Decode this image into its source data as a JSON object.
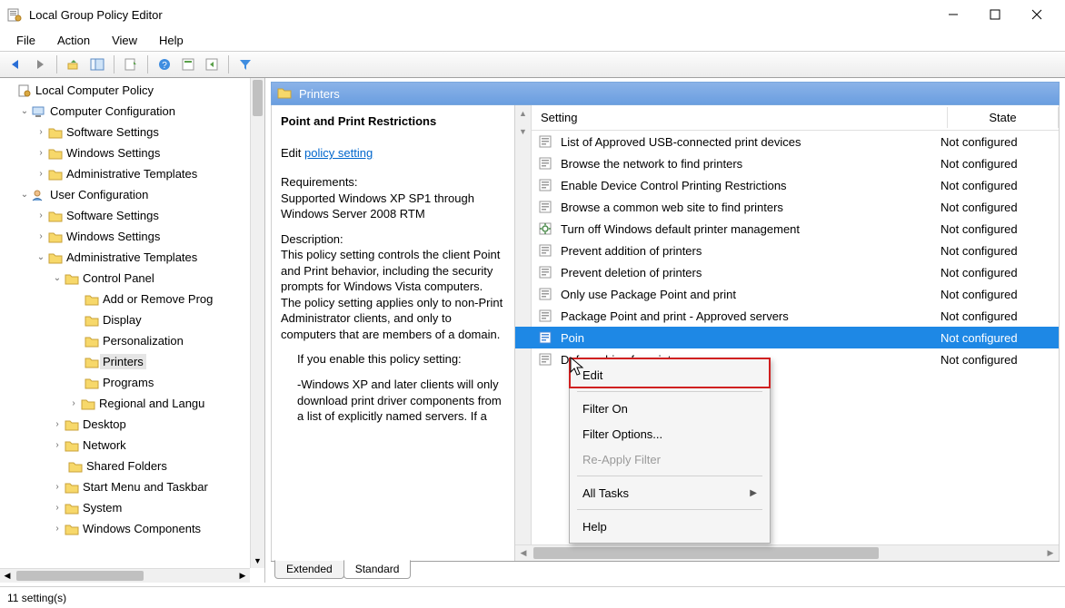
{
  "window": {
    "title": "Local Group Policy Editor"
  },
  "menu": {
    "file": "File",
    "action": "Action",
    "view": "View",
    "help": "Help"
  },
  "tree": {
    "root": "Local Computer Policy",
    "cc": "Computer Configuration",
    "uc": "User Configuration",
    "ss": "Software Settings",
    "ws": "Windows Settings",
    "at": "Administrative Templates",
    "cp": "Control Panel",
    "items_cp": {
      "addremove": "Add or Remove Prog",
      "display": "Display",
      "personalization": "Personalization",
      "printers": "Printers",
      "programs": "Programs",
      "regional": "Regional and Langu"
    },
    "desktop": "Desktop",
    "network": "Network",
    "shared": "Shared Folders",
    "start": "Start Menu and Taskbar",
    "system": "System",
    "wincomp": "Windows Components"
  },
  "pane": {
    "header": "Printers",
    "desc_title": "Point and Print Restrictions",
    "edit_label": "Edit",
    "edit_link": "policy setting",
    "req_h": "Requirements:",
    "req_t": "Supported Windows XP SP1 through Windows Server 2008 RTM",
    "desc_h": "Description:",
    "desc_t": "This policy setting controls the client Point and Print behavior, including the security prompts for Windows Vista computers. The policy setting applies only to non-Print Administrator clients, and only to computers that are members of a domain.",
    "desc_t2": "If you enable this policy setting:",
    "desc_t3": "-Windows XP and later clients will only download print driver components from a list of explicitly named servers. If a"
  },
  "listHeader": {
    "setting": "Setting",
    "state": "State"
  },
  "settings": [
    {
      "name": "List of Approved USB-connected print devices",
      "state": "Not configured"
    },
    {
      "name": "Browse the network to find printers",
      "state": "Not configured"
    },
    {
      "name": "Enable Device Control Printing Restrictions",
      "state": "Not configured"
    },
    {
      "name": "Browse a common web site to find printers",
      "state": "Not configured"
    },
    {
      "name": "Turn off Windows default printer management",
      "state": "Not configured"
    },
    {
      "name": "Prevent addition of printers",
      "state": "Not configured"
    },
    {
      "name": "Prevent deletion of printers",
      "state": "Not configured"
    },
    {
      "name": "Only use Package Point and print",
      "state": "Not configured"
    },
    {
      "name": "Package Point and print - Approved servers",
      "state": "Not configured"
    },
    {
      "name": "Poin",
      "state": "Not configured",
      "selected": true
    },
    {
      "name": "Defa                                                                          arching for printers",
      "state": "Not configured"
    }
  ],
  "ctx": {
    "edit": "Edit",
    "filteron": "Filter On",
    "filteropts": "Filter Options...",
    "reapply": "Re-Apply Filter",
    "alltasks": "All Tasks",
    "help": "Help"
  },
  "tabs": {
    "extended": "Extended",
    "standard": "Standard"
  },
  "status": "11 setting(s)"
}
